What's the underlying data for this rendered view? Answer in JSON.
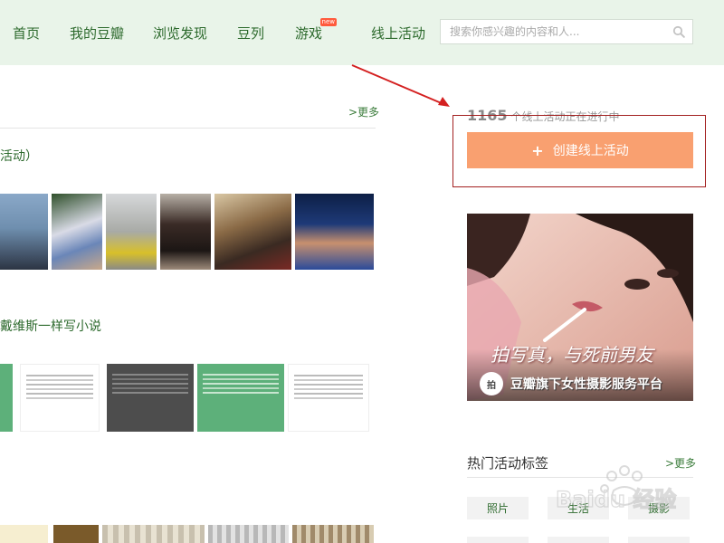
{
  "nav": {
    "items": [
      "首页",
      "我的豆瓣",
      "浏览发现",
      "豆列",
      "游戏",
      "线上活动"
    ],
    "new_badge": "new",
    "search_placeholder": "搜索你感兴趣的内容和人..."
  },
  "left": {
    "more_label": ">更多",
    "section1_heading_tail": "活动）",
    "section2_heading_tail": "戴维斯一样写小说"
  },
  "right": {
    "count_number": "1165",
    "count_text": "个线上活动正在进行中",
    "create_plus": "+",
    "create_label": "创建线上活动",
    "ad": {
      "slogan": "拍写真，与死前男友",
      "logo_text": "拍",
      "tagline": "豆瓣旗下女性摄影服务平台"
    },
    "hot_tags_title": "热门活动标签",
    "more_label": ">更多",
    "tags": [
      "照片",
      "生活",
      "摄影"
    ]
  },
  "watermark": {
    "text": "Baidu 经验"
  },
  "colors": {
    "nav_bg": "#e9f4e9",
    "nav_text": "#2d6a2d",
    "create_button": "#f9a070",
    "highlight_box": "#a32020",
    "arrow": "#d42020"
  }
}
